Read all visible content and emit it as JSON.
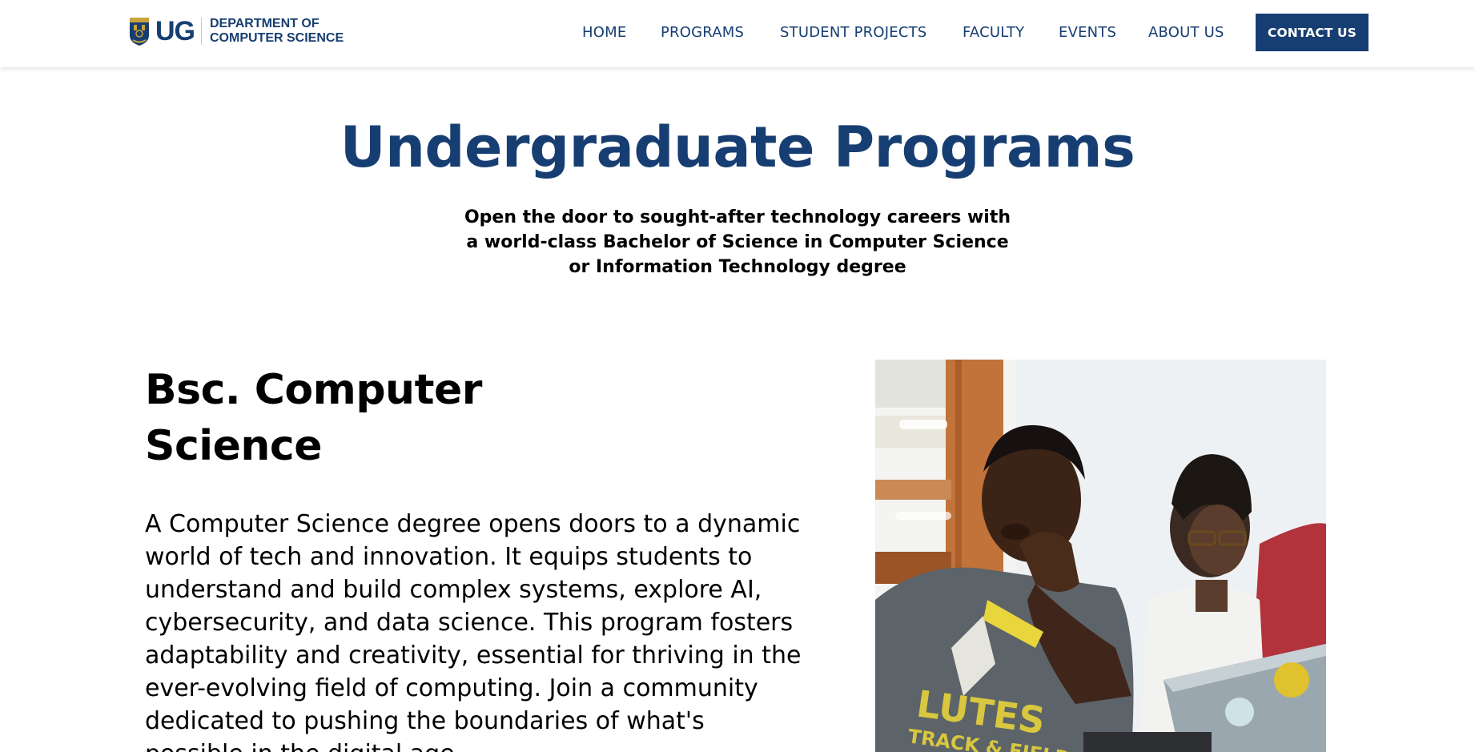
{
  "header": {
    "logo": {
      "ug": "UG",
      "dept_line1": "DEPARTMENT OF",
      "dept_line2": "COMPUTER SCIENCE"
    },
    "nav": [
      {
        "label": "HOME"
      },
      {
        "label": "PROGRAMS"
      },
      {
        "label": "STUDENT PROJECTS"
      },
      {
        "label": "FACULTY"
      },
      {
        "label": "EVENTS"
      },
      {
        "label": "ABOUT US"
      }
    ],
    "contact_label": "CONTACT US"
  },
  "hero": {
    "title": "Undergraduate Programs",
    "subtitle": "Open the door to sought-after technology careers with a world-class Bachelor of Science in Computer Science or Information Technology degree"
  },
  "program": {
    "title": "Bsc. Computer Science",
    "description": "A Computer Science degree opens doors to a dynamic world of tech and innovation. It equips students to understand and build complex systems, explore AI, cybersecurity, and data science. This program fosters adaptability and creativity, essential for thriving in the ever-evolving field of computing. Join a community dedicated to pushing the boundaries of what's possible in the digital age.",
    "photo_shirt_text": "LUTES",
    "photo_shirt_text2": "TRACK & FIELD"
  },
  "colors": {
    "brand": "#173e72",
    "background": "#ffffff",
    "text": "#000000"
  },
  "icons": {
    "logo": "university-crest-icon"
  }
}
